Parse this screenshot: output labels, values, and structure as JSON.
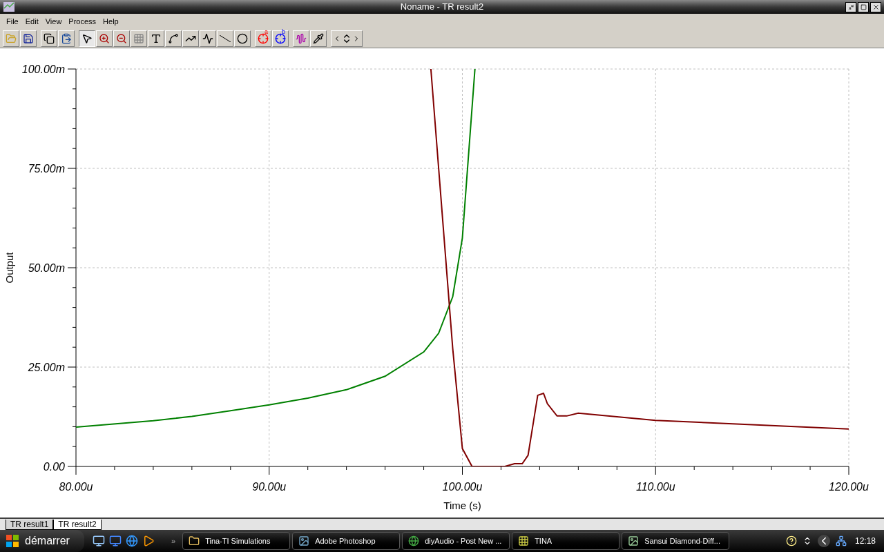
{
  "window": {
    "title": "Noname - TR result2"
  },
  "menu": [
    "File",
    "Edit",
    "View",
    "Process",
    "Help"
  ],
  "toolbar": [
    [
      {
        "kind": "open",
        "selected": false
      },
      {
        "kind": "save",
        "selected": false
      }
    ],
    [
      {
        "kind": "copy",
        "selected": false
      },
      {
        "kind": "paste",
        "selected": false
      }
    ],
    [
      {
        "kind": "pointer",
        "selected": true
      },
      {
        "kind": "zoom-in",
        "selected": false
      },
      {
        "kind": "zoom-out",
        "selected": false
      },
      {
        "kind": "grid",
        "selected": false
      },
      {
        "kind": "text",
        "selected": false
      },
      {
        "kind": "curve",
        "selected": false
      },
      {
        "kind": "curve2",
        "selected": false
      },
      {
        "kind": "wave",
        "selected": false
      },
      {
        "kind": "line",
        "selected": false
      },
      {
        "kind": "circle",
        "selected": false
      }
    ],
    [
      {
        "kind": "cursor",
        "label": "a",
        "color": "#ff0000",
        "selected": false
      },
      {
        "kind": "cursor",
        "label": "b",
        "color": "#0000ff",
        "selected": false
      }
    ],
    [
      {
        "kind": "add-curve",
        "selected": false
      },
      {
        "kind": "pipette",
        "selected": false
      }
    ],
    [
      {
        "kind": "nav",
        "selected": false
      }
    ]
  ],
  "chart": {
    "chart_data": {
      "type": "line",
      "xlabel": "Time (s)",
      "ylabel": "Output",
      "x": [
        80,
        84,
        86,
        88,
        90,
        92,
        94,
        96,
        98,
        98.37,
        98.77,
        99.5,
        100,
        100.5,
        100.65,
        102.2,
        102.7,
        103.1,
        103.4,
        103.9,
        104.2,
        104.4,
        104.9,
        105.4,
        106,
        110,
        115.4,
        120
      ],
      "series": [
        {
          "color": "#008000",
          "values": [
            9.9,
            11.5,
            12.6,
            14,
            15.5,
            17.2,
            19.3,
            22.7,
            28.8,
            null,
            33.5,
            42.7,
            57.5,
            null,
            100,
            null,
            null,
            null,
            null,
            null,
            null,
            null,
            null,
            null,
            null,
            null,
            null,
            null
          ]
        },
        {
          "color": "#800000",
          "values": [
            null,
            null,
            null,
            null,
            null,
            null,
            null,
            null,
            null,
            100,
            null,
            29.7,
            4.5,
            0,
            null,
            0,
            0.7,
            0.7,
            2.8,
            17.9,
            18.4,
            15.8,
            12.7,
            12.7,
            13.4,
            11.6,
            10.4,
            9.4
          ]
        }
      ],
      "grid": true,
      "xlim": [
        80,
        120
      ],
      "ylim": [
        0,
        100
      ],
      "xticks": [
        {
          "value": 80,
          "label": "80.00u"
        },
        {
          "value": 90,
          "label": "90.00u"
        },
        {
          "value": 100,
          "label": "100.00u"
        },
        {
          "value": 110,
          "label": "110.00u"
        },
        {
          "value": 120,
          "label": "120.00u"
        }
      ],
      "yticks": [
        {
          "value": 0,
          "label": "0.00"
        },
        {
          "value": 25,
          "label": "25.00m"
        },
        {
          "value": 50,
          "label": "50.00m"
        },
        {
          "value": 75,
          "label": "75.00m"
        },
        {
          "value": 100,
          "label": "100.00m"
        }
      ]
    }
  },
  "tabs": [
    {
      "label": "TR result1",
      "selected": false
    },
    {
      "label": "TR result2",
      "selected": true
    }
  ],
  "taskbar": {
    "start": "démarrer",
    "more": "»",
    "tasks": [
      {
        "label": "Tina-TI Simulations",
        "kind": "folder"
      },
      {
        "label": "Adobe Photoshop",
        "kind": "ps"
      },
      {
        "label": "diyAudio - Post New ...",
        "kind": "browser"
      },
      {
        "label": "TINA",
        "kind": "tina"
      },
      {
        "label": "Sansui Diamond-Diff...",
        "kind": "image"
      }
    ],
    "clock": "12:18"
  }
}
